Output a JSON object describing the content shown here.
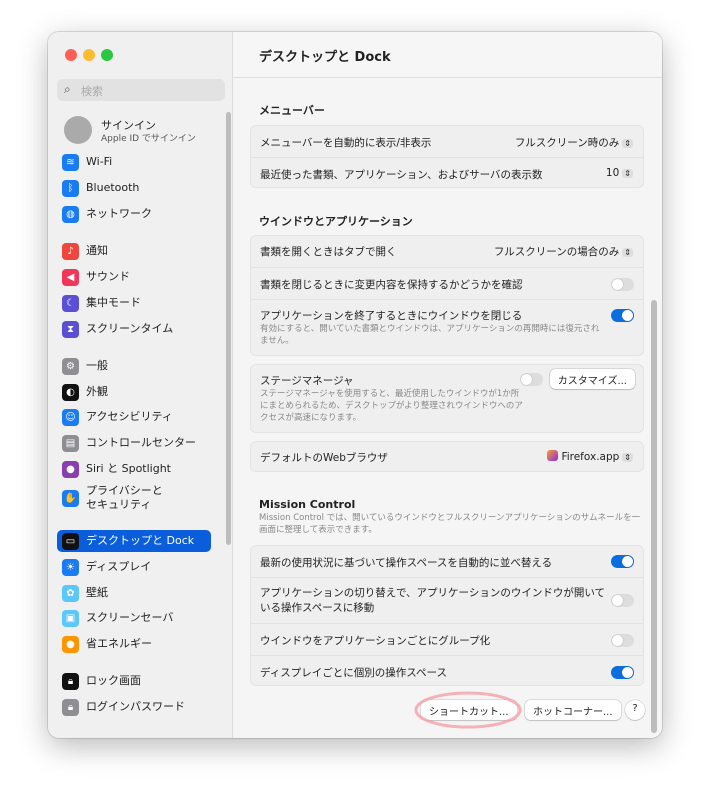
{
  "window": {
    "controls": {
      "close": "#fe5f57",
      "minimize": "#febc2e",
      "zoom": "#28c840"
    }
  },
  "sidebar": {
    "search_placeholder": "検索",
    "profile": {
      "name": "サインイン",
      "subtitle": "Apple ID でサインイン"
    },
    "items": [
      {
        "label": "Wi-Fi",
        "icon": "wifi-icon",
        "color": "#1a7cf5"
      },
      {
        "label": "Bluetooth",
        "icon": "bluetooth-icon",
        "color": "#1a7cf5"
      },
      {
        "label": "ネットワーク",
        "icon": "globe-icon",
        "color": "#1a7cf5"
      },
      {
        "label": "通知",
        "icon": "bell-icon",
        "color": "#f0463c"
      },
      {
        "label": "サウンド",
        "icon": "speaker-icon",
        "color": "#f0365a"
      },
      {
        "label": "集中モード",
        "icon": "moon-icon",
        "color": "#5b4fd6"
      },
      {
        "label": "スクリーンタイム",
        "icon": "hourglass-icon",
        "color": "#5b4fd6"
      },
      {
        "label": "一般",
        "icon": "gear-icon",
        "color": "#8e8e93"
      },
      {
        "label": "外観",
        "icon": "appearance-icon",
        "color": "#111111"
      },
      {
        "label": "アクセシビリティ",
        "icon": "accessibility-icon",
        "color": "#1a7cf5"
      },
      {
        "label": "コントロールセンター",
        "icon": "control-center-icon",
        "color": "#8e8e93"
      },
      {
        "label": "Siri と Spotlight",
        "icon": "siri-icon",
        "color": "#8a3fb0"
      },
      {
        "label": "プライバシーと\nセキュリティ",
        "icon": "hand-icon",
        "color": "#1a7cf5"
      },
      {
        "label": "デスクトップと Dock",
        "icon": "desktop-dock-icon",
        "color": "#111111",
        "selected": true
      },
      {
        "label": "ディスプレイ",
        "icon": "sun-icon",
        "color": "#1a7cf5"
      },
      {
        "label": "壁紙",
        "icon": "wallpaper-icon",
        "color": "#5ac8fa"
      },
      {
        "label": "スクリーンセーバ",
        "icon": "screensaver-icon",
        "color": "#5ac8fa"
      },
      {
        "label": "省エネルギー",
        "icon": "bulb-icon",
        "color": "#ff9500"
      },
      {
        "label": "ロック画面",
        "icon": "lock-screen-icon",
        "color": "#111111"
      },
      {
        "label": "ログインパスワード",
        "icon": "lock-icon",
        "color": "#8e8e93"
      }
    ]
  },
  "main": {
    "title": "デスクトップと Dock",
    "menubar": {
      "heading": "メニューバー",
      "rows": [
        {
          "label": "メニューバーを自動的に表示/非表示",
          "value": "フルスクリーン時のみ"
        },
        {
          "label": "最近使った書類、アプリケーション、およびサーバの表示数",
          "value": "10"
        }
      ]
    },
    "windows": {
      "heading": "ウインドウとアプリケーション",
      "rows": [
        {
          "label": "書類を開くときはタブで開く",
          "value": "フルスクリーンの場合のみ"
        },
        {
          "label": "書類を閉じるときに変更内容を保持するかどうかを確認",
          "toggle": false
        },
        {
          "label": "アプリケーションを終了するときにウインドウを閉じる",
          "toggle": true,
          "desc": "有効にすると、開いていた書類とウインドウは、アプリケーションの再開時には復元されません。"
        }
      ]
    },
    "stage": {
      "label": "ステージマネージャ",
      "toggle": false,
      "desc": "ステージマネージャを使用すると、最近使用したウインドウが1か所にまとめられるため、デスクトップがより整理されウインドウへのアクセスが高速になります。",
      "button": "カスタマイズ..."
    },
    "browser": {
      "label": "デフォルトのWebブラウザ",
      "value": "Firefox.app"
    },
    "mission": {
      "heading": "Mission Control",
      "desc": "Mission Control では、開いているウインドウとフルスクリーンアプリケーションのサムネールを一画面に整理して表示できます。",
      "rows": [
        {
          "label": "最新の使用状況に基づいて操作スペースを自動的に並べ替える",
          "toggle": true
        },
        {
          "label": "アプリケーションの切り替えで、アプリケーションのウインドウが開いている操作スペースに移動",
          "toggle": false
        },
        {
          "label": "ウインドウをアプリケーションごとにグループ化",
          "toggle": false
        },
        {
          "label": "ディスプレイごとに個別の操作スペース",
          "toggle": true
        }
      ]
    },
    "buttons": {
      "shortcuts": "ショートカット...",
      "hot_corners": "ホットコーナー...",
      "help": "?"
    }
  }
}
